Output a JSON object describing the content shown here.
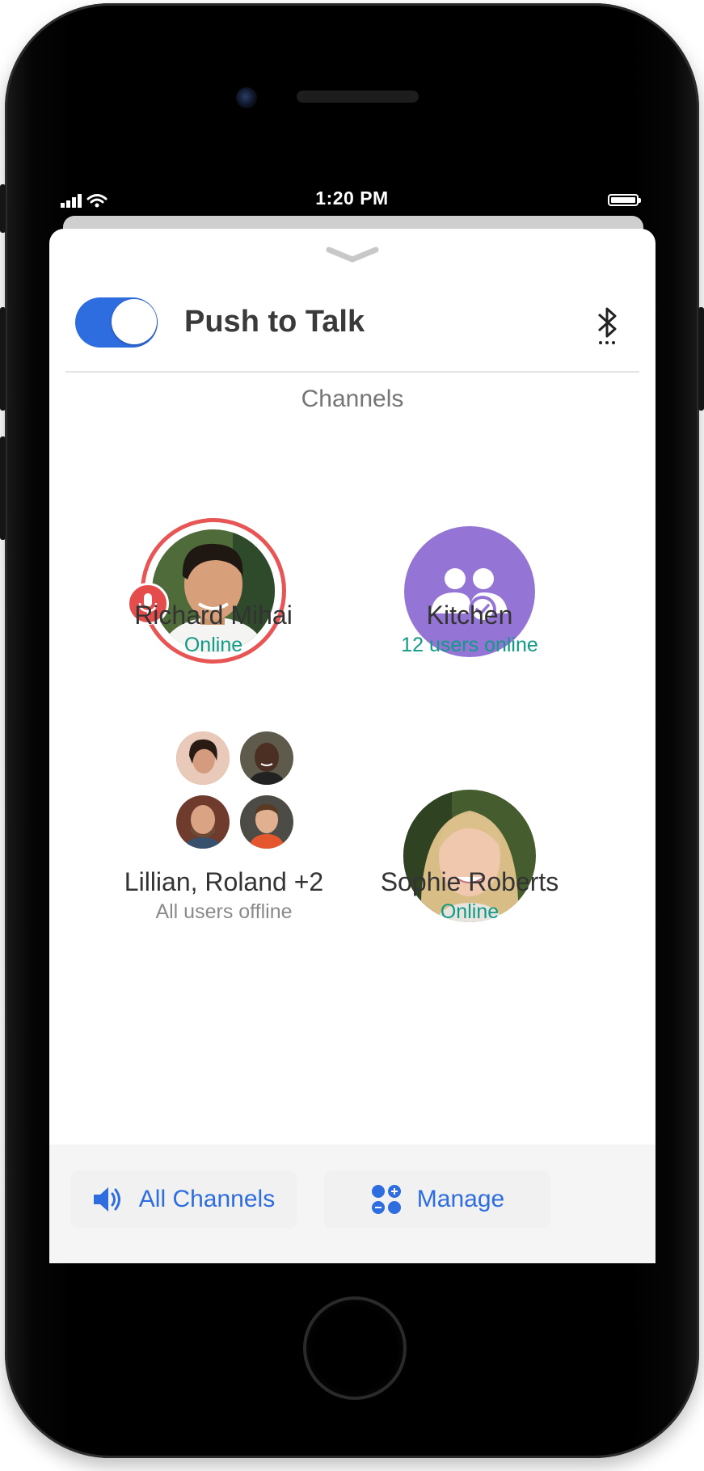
{
  "status_bar": {
    "time": "1:20 PM"
  },
  "header": {
    "title": "Push to Talk",
    "toggle_on": true
  },
  "section": {
    "title": "Channels"
  },
  "channels": [
    {
      "name": "Richard Mihai",
      "status": "Online",
      "talking": true
    },
    {
      "name": "Kitchen",
      "status": "12 users online"
    },
    {
      "name": "Lillian, Roland +2",
      "status": "All users offline"
    },
    {
      "name": "Sophie Roberts",
      "status": "Online"
    }
  ],
  "bottom_bar": {
    "all_channels_label": "All Channels",
    "manage_label": "Manage"
  },
  "colors": {
    "accent": "#2e6de0",
    "online": "#119a86",
    "talking_ring": "#e85555",
    "group": "#9475d6"
  },
  "icons": [
    "signal-icon",
    "wifi-icon",
    "battery-icon",
    "chevron-down-icon",
    "bluetooth-icon",
    "microphone-icon",
    "group-check-icon",
    "speaker-icon",
    "manage-grid-icon"
  ]
}
